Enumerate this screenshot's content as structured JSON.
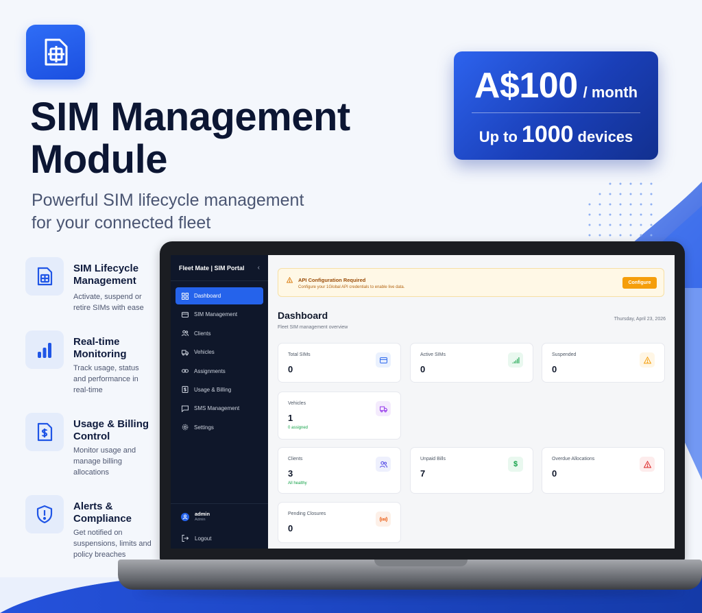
{
  "hero": {
    "title_line1": "SIM Management",
    "title_line2": "Module",
    "subtitle_line1": "Powerful SIM lifecycle management",
    "subtitle_line2": "for your connected fleet"
  },
  "pricing": {
    "amount": "A$100",
    "period": "/ month",
    "limit_prefix": "Up to",
    "limit_count": "1000",
    "limit_suffix": "devices"
  },
  "features": [
    {
      "icon": "sim-card-icon",
      "title": "SIM Lifecycle Management",
      "desc": "Activate, suspend or retire SIMs with ease"
    },
    {
      "icon": "bar-chart-icon",
      "title": "Real-time Monitoring",
      "desc": "Track usage, status and performance in real-time"
    },
    {
      "icon": "billing-document-icon",
      "title": "Usage & Billing Control",
      "desc": "Monitor usage and manage billing allocations"
    },
    {
      "icon": "shield-alert-icon",
      "title": "Alerts & Compliance",
      "desc": "Get notified on suspensions, limits and policy breaches"
    }
  ],
  "portal": {
    "sidebar_title": "Fleet Mate | SIM Portal",
    "nav": [
      {
        "label": "Dashboard",
        "icon": "grid-icon",
        "active": true
      },
      {
        "label": "SIM Management",
        "icon": "card-icon"
      },
      {
        "label": "Clients",
        "icon": "users-icon"
      },
      {
        "label": "Vehicles",
        "icon": "truck-icon"
      },
      {
        "label": "Assignments",
        "icon": "link-icon"
      },
      {
        "label": "Usage & Billing",
        "icon": "dollar-icon"
      },
      {
        "label": "SMS Management",
        "icon": "message-icon"
      },
      {
        "label": "Settings",
        "icon": "gear-icon"
      }
    ],
    "user": {
      "name": "admin",
      "role": "Admin"
    },
    "logout_label": "Logout",
    "alert": {
      "title": "API Configuration Required",
      "text": "Configure your 1Global API credentials to enable live data.",
      "button": "Configure"
    },
    "dashboard": {
      "title": "Dashboard",
      "subtitle": "Fleet SIM management overview",
      "date": "Thursday, April 23, 2026"
    },
    "cards": [
      {
        "label": "Total SIMs",
        "value": "0",
        "note": "",
        "icon": "card-icon",
        "color": "#2563eb",
        "bg": "#eaf1fe"
      },
      {
        "label": "Active SIMs",
        "value": "0",
        "note": "",
        "icon": "signal-icon",
        "color": "#16a34a",
        "bg": "#e9f8ef"
      },
      {
        "label": "Suspended",
        "value": "0",
        "note": "",
        "icon": "warning-icon",
        "color": "#f59e0b",
        "bg": "#fff6e5"
      },
      {
        "label": "Vehicles",
        "value": "1",
        "note": "0 assigned",
        "icon": "truck-icon",
        "color": "#9333ea",
        "bg": "#f4ebfd"
      },
      {
        "label": "Clients",
        "value": "3",
        "note": "All healthy",
        "icon": "users-icon",
        "color": "#4f46e5",
        "bg": "#eef0fd"
      },
      {
        "label": "Unpaid Bills",
        "value": "7",
        "note": "",
        "icon": "dollar-icon",
        "color": "#16a34a",
        "bg": "#e9f8ef"
      },
      {
        "label": "Overdue Allocations",
        "value": "0",
        "note": "",
        "icon": "alert-triangle-icon",
        "color": "#dc2626",
        "bg": "#fdecec"
      },
      {
        "label": "Pending Closures",
        "value": "0",
        "note": "",
        "icon": "broadcast-icon",
        "color": "#ea580c",
        "bg": "#fdf0e8"
      }
    ]
  }
}
